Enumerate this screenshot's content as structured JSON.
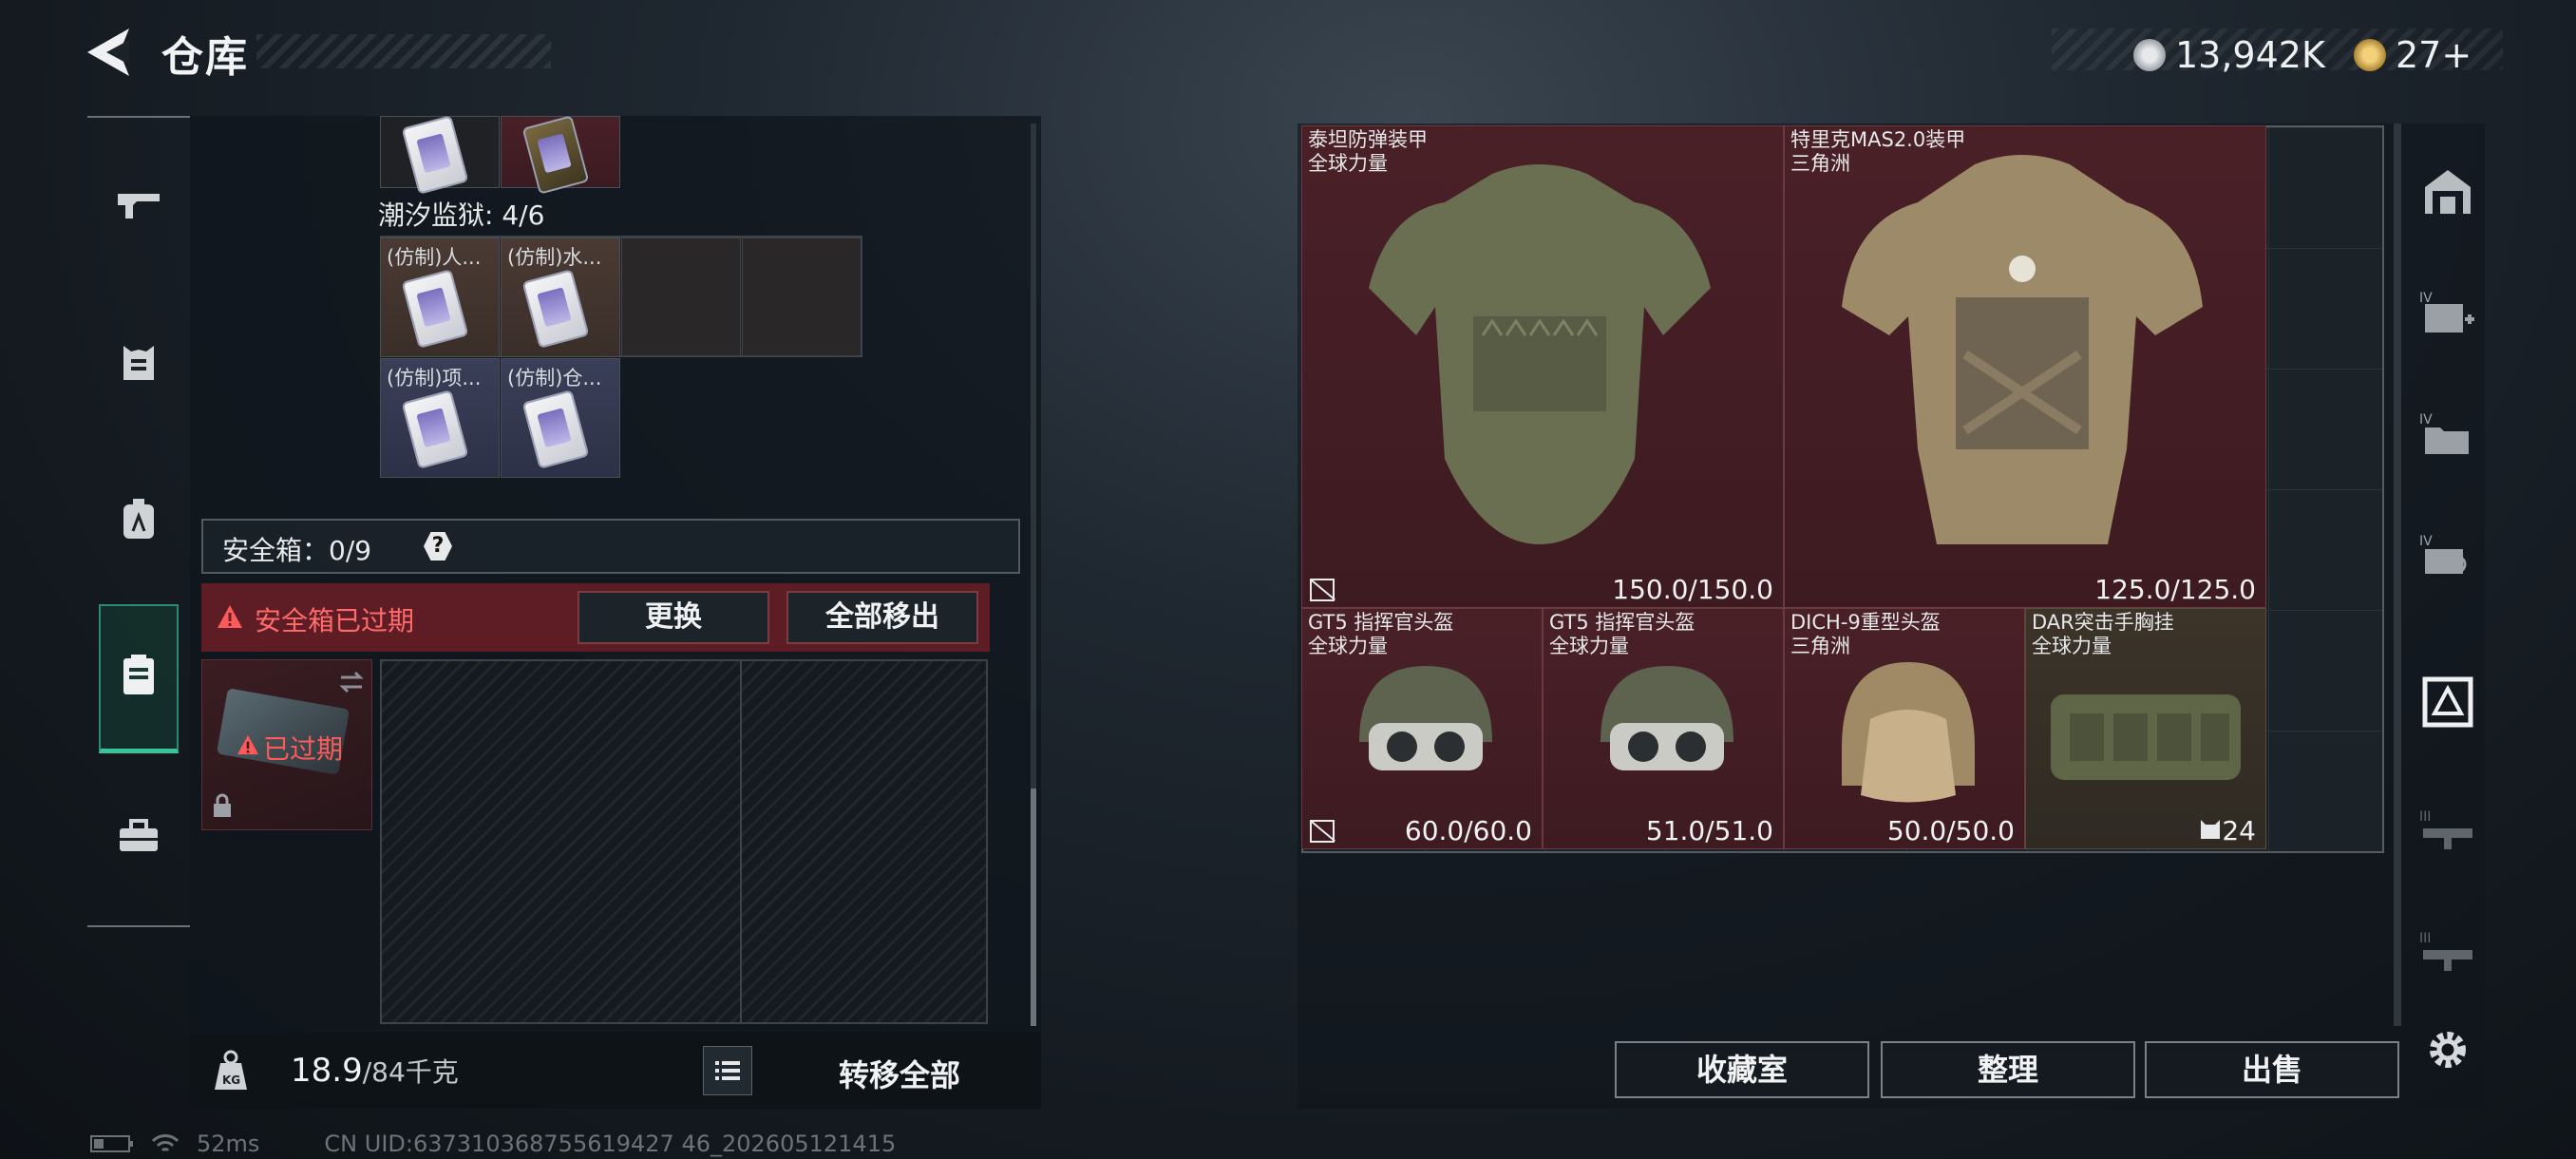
{
  "header": {
    "title": "仓库",
    "currency_amount": "13,942K",
    "coupon_amount": "27+"
  },
  "left_nav": {
    "items": [
      "gun-icon",
      "armor-icon",
      "backpack-icon",
      "safe-box-icon",
      "toolbox-icon"
    ],
    "active_index": 3
  },
  "container": {
    "top_items": [
      {
        "label": ""
      },
      {
        "label": ""
      }
    ],
    "prison_label": "潮汐监狱: 4/6",
    "prison_items": [
      {
        "label": "(仿制)人..."
      },
      {
        "label": "(仿制)水..."
      },
      {
        "label": "(仿制)项..."
      },
      {
        "label": "(仿制)仓..."
      }
    ],
    "safe_box_label": "安全箱：0/9",
    "help": "?",
    "expired_warning": "安全箱已过期",
    "replace_button": "更换",
    "remove_all_button": "全部移出",
    "expired_tag": "已过期"
  },
  "footer_left": {
    "weight_current": "18.9",
    "weight_max": "/84千克",
    "transfer_all": "转移全部"
  },
  "inventory": {
    "items": [
      {
        "name1": "泰坦防弹装甲",
        "name2": "全球力量",
        "value": "150.0/150.0"
      },
      {
        "name1": "特里克MAS2.0装甲",
        "name2": "三角洲",
        "value": "125.0/125.0"
      },
      {
        "name1": "GT5 指挥官头盔",
        "name2": "全球力量",
        "value": "60.0/60.0"
      },
      {
        "name1": "GT5 指挥官头盔",
        "name2": "全球力量",
        "value": "51.0/51.0"
      },
      {
        "name1": "DICH-9重型头盔",
        "name2": "三角洲",
        "value": "50.0/50.0"
      },
      {
        "name1": "DAR突击手胸挂",
        "name2": "全球力量",
        "value": "24"
      }
    ]
  },
  "actions": {
    "collection": "收藏室",
    "organize": "整理",
    "sell": "出售"
  },
  "status": {
    "ping": "52ms",
    "uid": "CN UID:637310368755619427 46_202605121415"
  },
  "colors": {
    "accent_green": "#33c79a",
    "warning_red": "#e04a4a",
    "item_red": "#4a2027"
  }
}
